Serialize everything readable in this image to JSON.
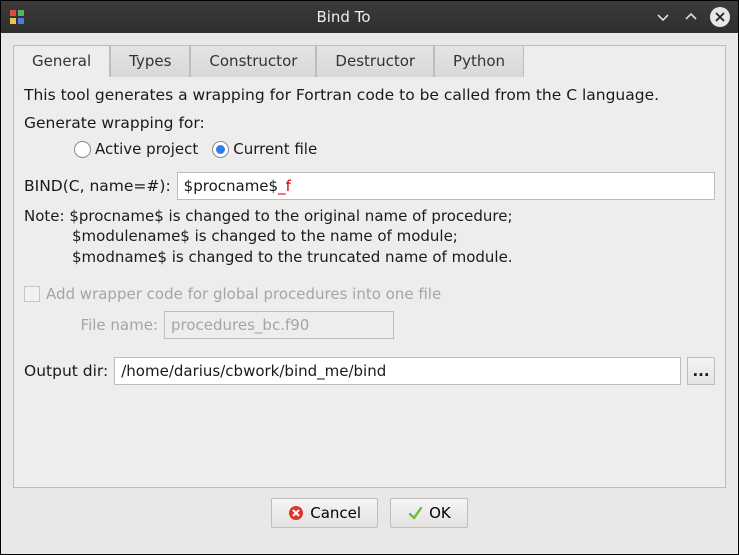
{
  "window": {
    "title": "Bind To"
  },
  "tabs": {
    "t0": "General",
    "t1": "Types",
    "t2": "Constructor",
    "t3": "Destructor",
    "t4": "Python",
    "active": 0
  },
  "general": {
    "description": "This tool generates a wrapping for Fortran code to be called from the C language.",
    "generate_label": "Generate wrapping for:",
    "radio_active": "Active project",
    "radio_current": "Current file",
    "selected_radio": "current",
    "bind_label": "BIND(C, name=#):",
    "bind_value_base": "$procname$",
    "bind_value_suffix": "_f",
    "note_prefix": "Note: ",
    "note_line1": "$procname$ is changed to the original name of procedure;",
    "note_line2": "$modulename$ is changed to the name of module;",
    "note_line3": "$modname$ is changed to the truncated name of module.",
    "add_wrapper_label": "Add wrapper code for global procedures into one file",
    "add_wrapper_checked": false,
    "filename_label": "File name:",
    "filename_placeholder": "procedures_bc.f90",
    "output_label": "Output dir:",
    "output_value": "/home/darius/cbwork/bind_me/bind",
    "browse_label": "..."
  },
  "buttons": {
    "cancel": "Cancel",
    "ok": "OK"
  }
}
